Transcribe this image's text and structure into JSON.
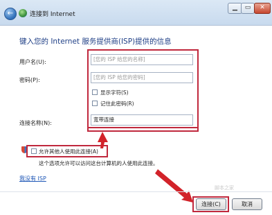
{
  "window": {
    "title": "连接到 Internet"
  },
  "titlebar": {
    "back_icon": "←",
    "minimize": "▁",
    "maximize": "▭",
    "close": "✕"
  },
  "heading": "键入您的 Internet 服务提供商(ISP)提供的信息",
  "form": {
    "username_label": "用户名(U):",
    "username_placeholder": "[您的 ISP 给您的名称]",
    "password_label": "密码(P):",
    "password_placeholder": "[您的 ISP 给您的密码]",
    "show_chars_label": "显示字符(S)",
    "remember_password_label": "记住此密码(R)",
    "connection_name_label": "连接名称(N):",
    "connection_name_value": "宽带连接",
    "allow_others_label": "允许其他人使用此连接(A)",
    "allow_others_desc": "这个选项允许可以访问这台计算机的人使用此连接。",
    "no_isp_link": "我没有 ISP"
  },
  "buttons": {
    "connect": "连接(C)",
    "cancel": "取消"
  },
  "watermark": "脚本之家",
  "colors": {
    "annotation_red": "#c0283d",
    "heading_blue": "#1f3f86"
  }
}
